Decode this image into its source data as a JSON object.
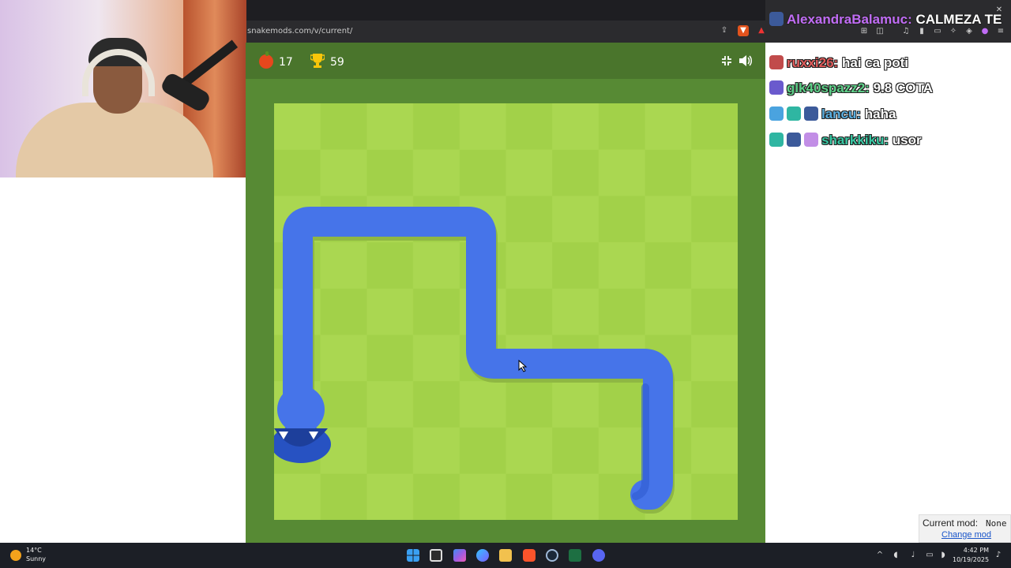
{
  "browser": {
    "url": "snakemods.com/v/current/"
  },
  "game": {
    "apples": "17",
    "best": "59",
    "colors": {
      "board_light": "#aad751",
      "board_dark": "#a2d149",
      "border": "#578a34",
      "header": "#4a752c",
      "snake": "#4674e9"
    }
  },
  "chat": {
    "messages": [
      {
        "user": "AlexandraBalamuc:",
        "text": "CALMEZA TE",
        "user_color": "#c06cf5"
      },
      {
        "user": "ruxxi26:",
        "text": "hai ca poti",
        "user_color": "#e05a5a"
      },
      {
        "user": "glk40spazz2:",
        "text": "9.8 COTA",
        "user_color": "#5fd18a"
      },
      {
        "user": "lancu:",
        "text": "haha",
        "user_color": "#5aaee0"
      },
      {
        "user": "sharkkiku:",
        "text": "usor",
        "user_color": "#38c7a3"
      }
    ]
  },
  "mod_box": {
    "label": "Current mod:",
    "value": "None",
    "link": "Change mod"
  },
  "taskbar": {
    "temperature": "14°C",
    "condition": "Sunny",
    "time": "4:42 PM",
    "date": "10/19/2025"
  }
}
